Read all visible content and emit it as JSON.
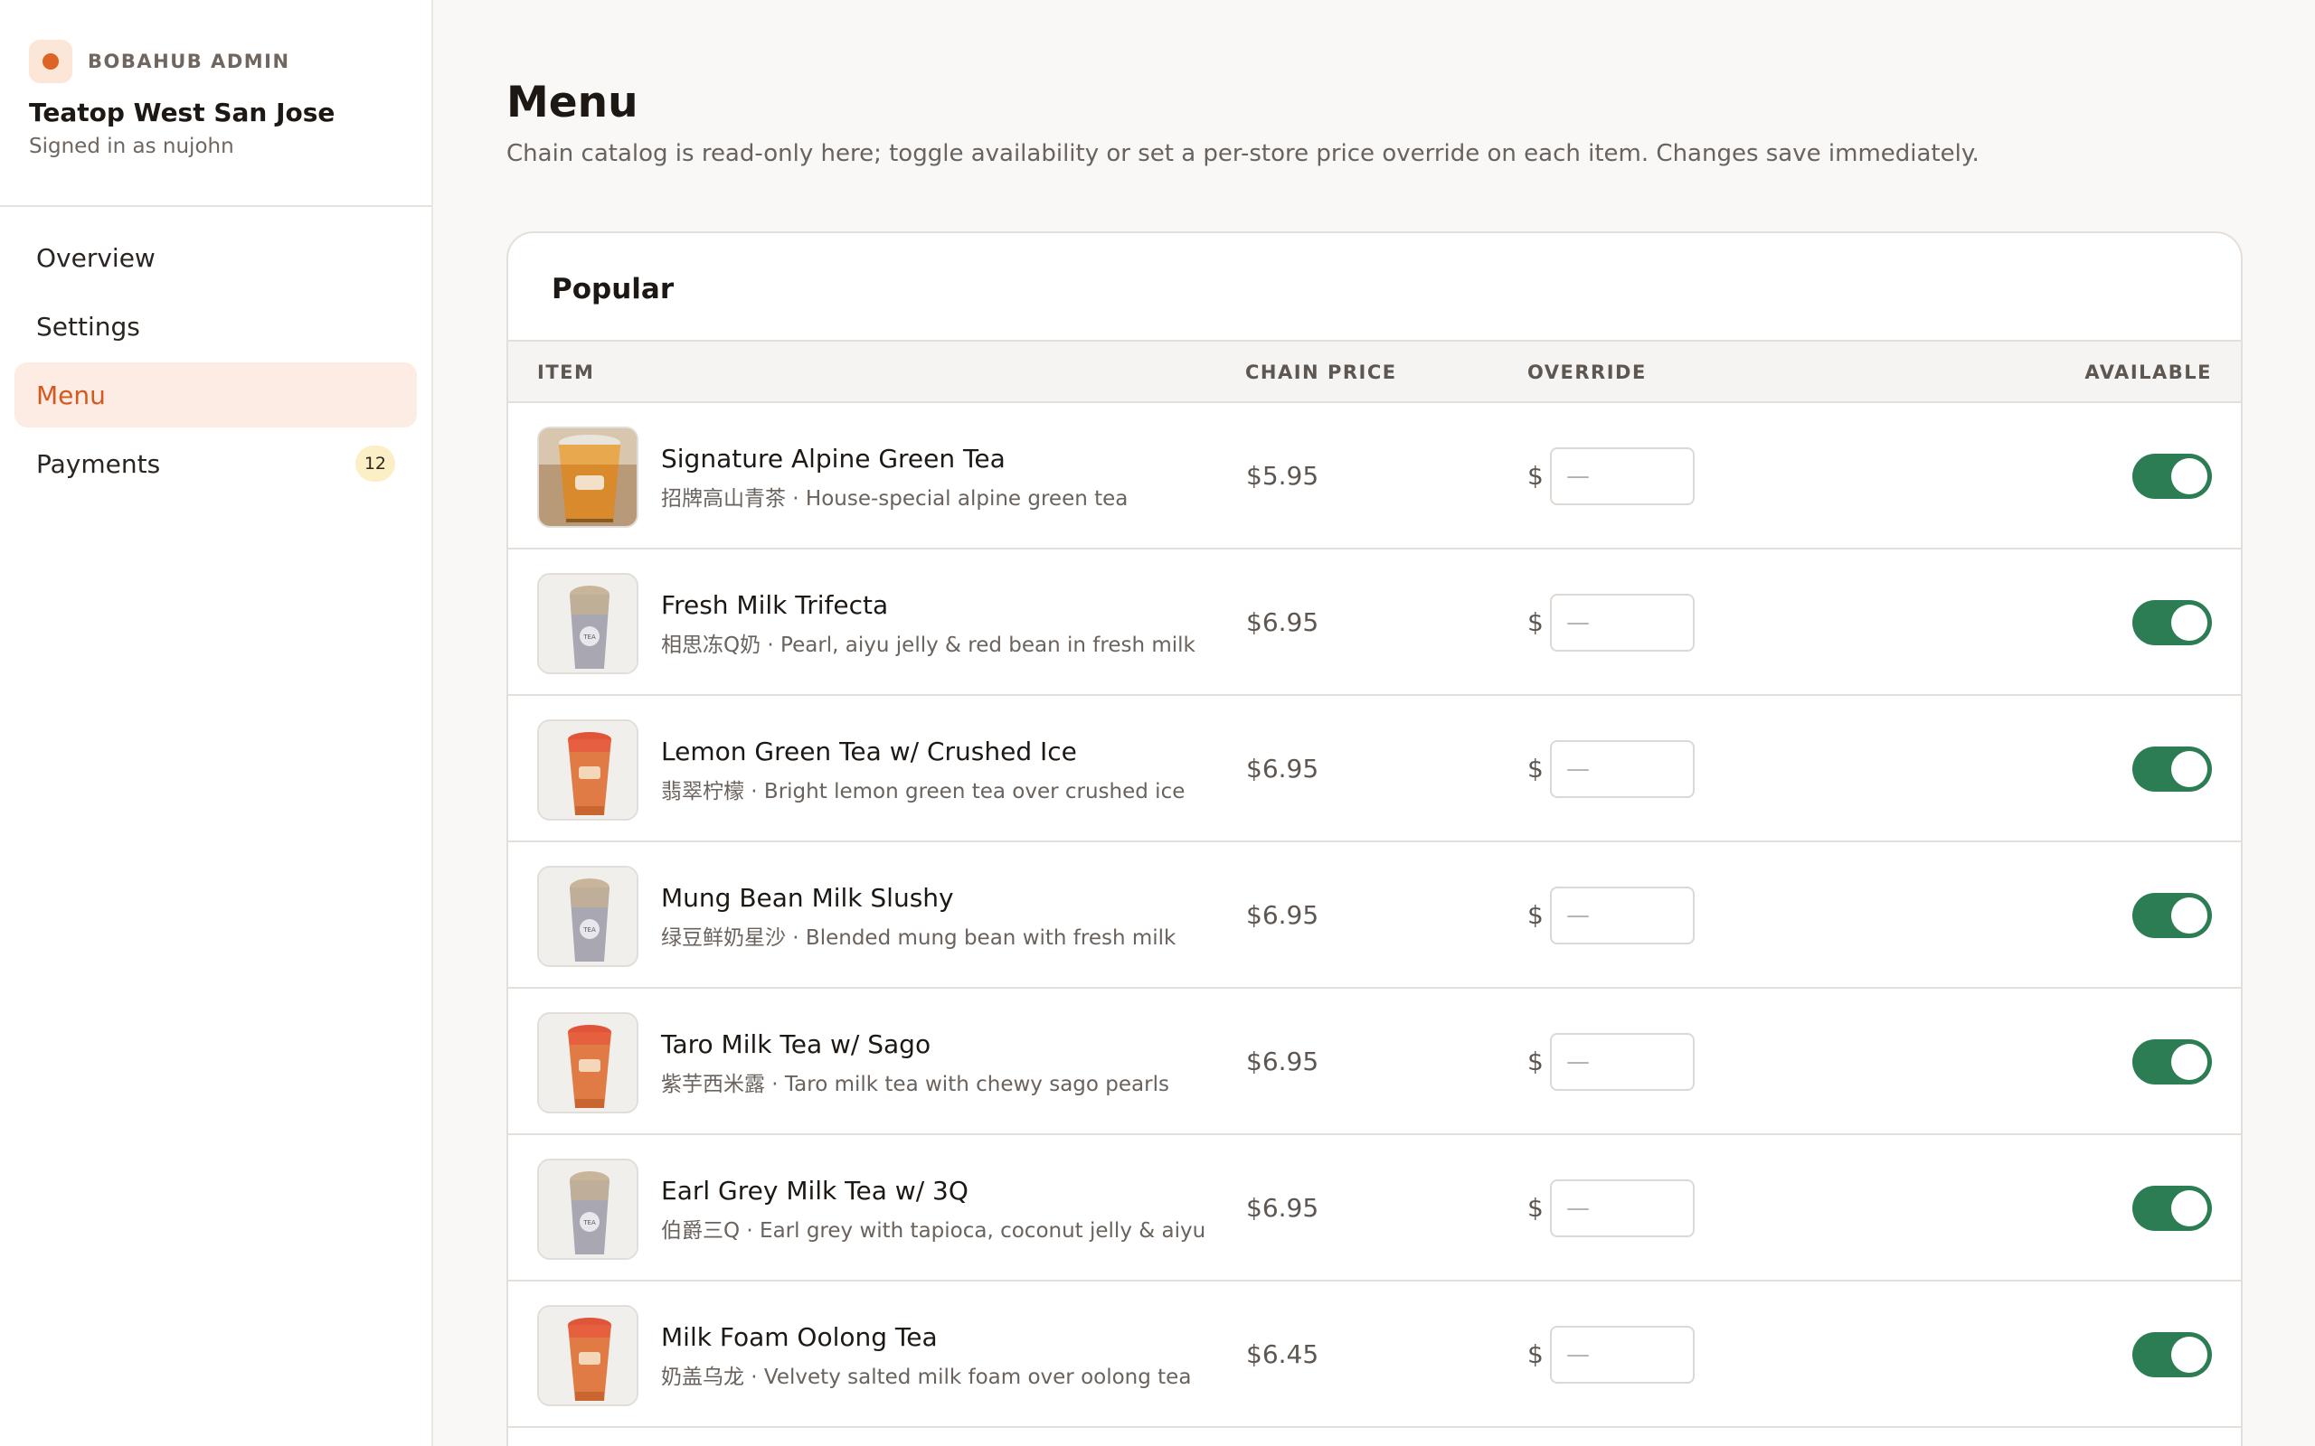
{
  "sidebar": {
    "brand_label": "BOBAHUB ADMIN",
    "store_name": "Teatop West San Jose",
    "signed_in": "Signed in as nujohn",
    "nav": [
      {
        "label": "Overview",
        "active": false
      },
      {
        "label": "Settings",
        "active": false
      },
      {
        "label": "Menu",
        "active": true
      },
      {
        "label": "Payments",
        "active": false,
        "badge": "12"
      }
    ]
  },
  "page": {
    "title": "Menu",
    "subtitle": "Chain catalog is read-only here; toggle availability or set a per-store price override on each item. Changes save immediately."
  },
  "section": {
    "title": "Popular",
    "columns": {
      "item": "ITEM",
      "chain_price": "CHAIN PRICE",
      "override": "OVERRIDE",
      "available": "AVAILABLE"
    },
    "currency_symbol": "$",
    "override_placeholder": "—",
    "items": [
      {
        "name": "Signature Alpine Green Tea",
        "desc": "招牌高山青茶 · House-special alpine green tea",
        "price": "$5.95",
        "available": true,
        "thumb": "photo-cup"
      },
      {
        "name": "Fresh Milk Trifecta",
        "desc": "相思冻Q奶 · Pearl, aiyu jelly & red bean in fresh milk",
        "price": "$6.95",
        "available": true,
        "thumb": "milk-cup"
      },
      {
        "name": "Lemon Green Tea w/ Crushed Ice",
        "desc": "翡翠柠檬 · Bright lemon green tea over crushed ice",
        "price": "$6.95",
        "available": true,
        "thumb": "orange-cup"
      },
      {
        "name": "Mung Bean Milk Slushy",
        "desc": "绿豆鲜奶星沙 · Blended mung bean with fresh milk",
        "price": "$6.95",
        "available": true,
        "thumb": "milk-cup"
      },
      {
        "name": "Taro Milk Tea w/ Sago",
        "desc": "紫芋西米露 · Taro milk tea with chewy sago pearls",
        "price": "$6.95",
        "available": true,
        "thumb": "orange-cup"
      },
      {
        "name": "Earl Grey Milk Tea w/ 3Q",
        "desc": "伯爵三Q · Earl grey with tapioca, coconut jelly & aiyu",
        "price": "$6.95",
        "available": true,
        "thumb": "milk-cup"
      },
      {
        "name": "Milk Foam Oolong Tea",
        "desc": "奶盖乌龙 · Velvety salted milk foam over oolong tea",
        "price": "$6.45",
        "available": true,
        "thumb": "orange-cup"
      }
    ]
  },
  "colors": {
    "accent": "#d4581f",
    "toggle_on": "#2c7d54",
    "badge_bg": "#fcefc6",
    "active_nav_bg": "#fcece3"
  }
}
